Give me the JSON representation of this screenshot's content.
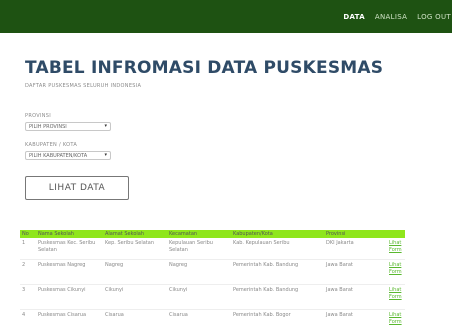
{
  "nav": {
    "data": "DATA",
    "analisa": "ANALISA",
    "logout": "LOG OUT"
  },
  "page": {
    "title": "TABEL INFROMASI DATA PUSKESMAS",
    "subtitle": "DAFTAR PUSKESMAS SELURUH INDONESIA"
  },
  "filters": {
    "provinsi_label": "PROVINSI",
    "provinsi_value": "PILIH PROVINSI",
    "kabupaten_label": "KABUPATEN / KOTA",
    "kabupaten_value": "PILIH KABUPATEN/KOTA",
    "button": "LIHAT DATA"
  },
  "table": {
    "headers": [
      "No",
      "Nama Sekolah",
      "Alamat Sekolah",
      "Kecamatan",
      "Kabupaten/Kota",
      "Provinsi",
      ""
    ],
    "rows": [
      [
        "1",
        "Puskesmas Kec. Seribu Selatan",
        "Kep. Seribu Selatan",
        "Kepulauan Seribu Selatan",
        "Kab. Kepulauan Seribu",
        "DKI Jakarta",
        "Lihat Form"
      ],
      [
        "2",
        "Puskesmas Nagreg",
        "Nagreg",
        "Nagreg",
        "Pemerintah Kab. Bandung",
        "Jawa Barat",
        "Lihat Form"
      ],
      [
        "3",
        "Puskesmas Cikunyi",
        "Cikunyi",
        "Cikunyi",
        "Pemerintah Kab. Bandung",
        "Jawa Barat",
        "Lihat Form"
      ],
      [
        "4",
        "Puskesmas Cisarua",
        "Cisarua",
        "Cisarua",
        "Pemerintah Kab. Bogor",
        "Jawa Barat",
        "Lihat Form"
      ]
    ]
  },
  "colors": {
    "topbar": "#1e5212",
    "header_row": "#8fe61c",
    "title": "#2f4b67",
    "link": "#59b82e"
  }
}
